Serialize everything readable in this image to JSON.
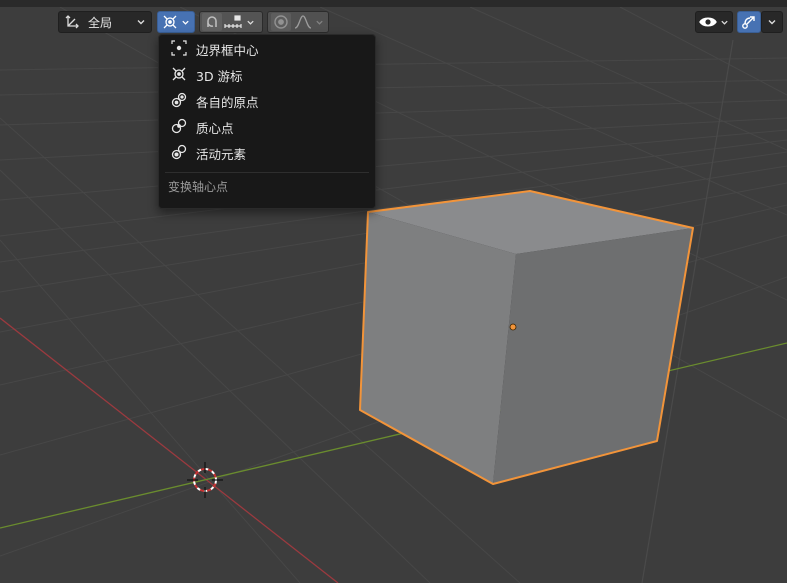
{
  "header": {
    "orientation": {
      "label": "全局",
      "icon": "transform-orientation-icon"
    },
    "pivot": {
      "icon": "3d-cursor-pivot-icon"
    },
    "snap": {
      "icon": "magnet-snap-icon",
      "increment_icon": "snap-increment-icon"
    },
    "proportional": {
      "icon": "proportional-edit-icon",
      "falloff_icon": "falloff-curve-icon"
    },
    "visibility": {
      "icon": "eye-icon"
    },
    "gizmo": {
      "icon": "gizmo-icon"
    }
  },
  "pivot_menu": {
    "items": [
      {
        "label": "边界框中心",
        "icon": "bounding-box-center-icon"
      },
      {
        "label": "3D 游标",
        "icon": "3d-cursor-icon"
      },
      {
        "label": "各自的原点",
        "icon": "individual-origins-icon"
      },
      {
        "label": "质心点",
        "icon": "median-point-icon"
      },
      {
        "label": "活动元素",
        "icon": "active-element-icon"
      }
    ],
    "title": "变换轴心点"
  },
  "colors": {
    "viewport_bg": "#3d3d3d",
    "accent_blue": "#4772b3",
    "selection_outline": "#f2943a",
    "x_axis": "#9b3a3f",
    "y_axis": "#6a8c2e"
  }
}
